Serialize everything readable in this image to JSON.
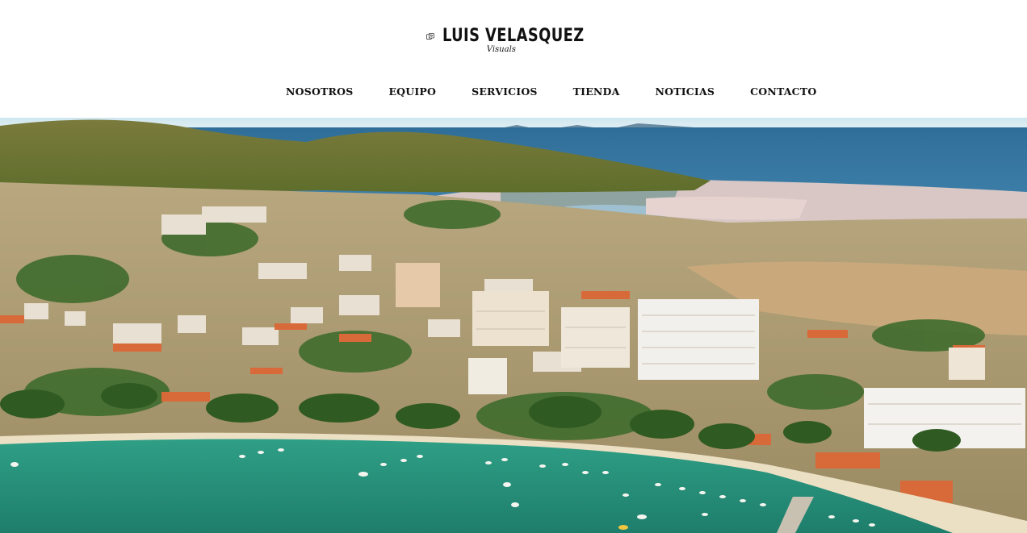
{
  "brand": {
    "name": "LUIS VELASQUEZ",
    "tagline": "Visuals"
  },
  "nav": {
    "items": [
      {
        "label": "NOSOTROS"
      },
      {
        "label": "EQUIPO"
      },
      {
        "label": "SERVICIOS"
      },
      {
        "label": "TIENDA"
      },
      {
        "label": "NOTICIAS"
      },
      {
        "label": "CONTACTO"
      }
    ]
  },
  "hero": {
    "description_icon": "aerial-coastal-town-photo"
  }
}
